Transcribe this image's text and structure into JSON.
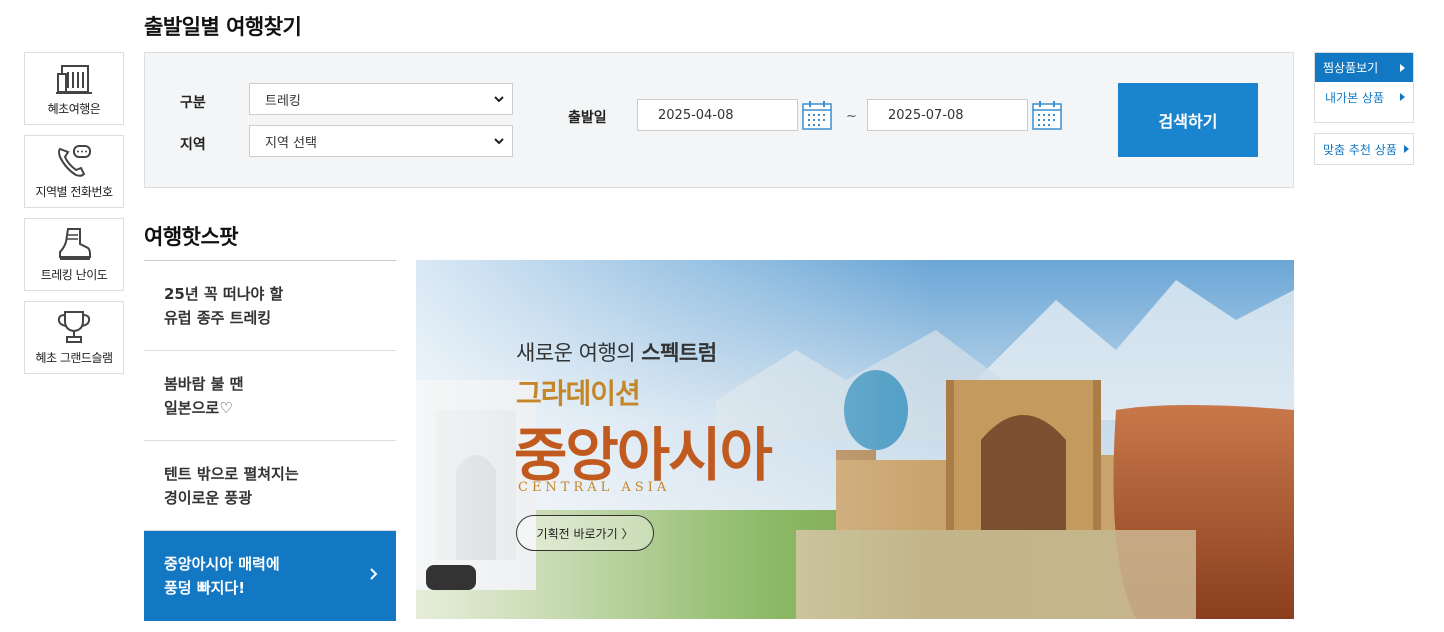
{
  "quick_menu": [
    {
      "label": "혜초여행은",
      "icon": "building-icon"
    },
    {
      "label": "지역별 전화번호",
      "icon": "phone-icon"
    },
    {
      "label": "트레킹 난이도",
      "icon": "boot-icon"
    },
    {
      "label": "혜초 그랜드슬램",
      "icon": "trophy-icon"
    }
  ],
  "search": {
    "title": "출발일별 여행찾기",
    "category_label": "구분",
    "category_value": "트레킹",
    "region_label": "지역",
    "region_value": "지역 선택",
    "date_label": "출발일",
    "date_from": "2025-04-08",
    "date_sep": "~",
    "date_to": "2025-07-08",
    "submit_label": "검색하기"
  },
  "hotspot": {
    "title": "여행핫스팟",
    "items": [
      {
        "line1": "25년 꼭 떠나야 할",
        "line2": "유럽 종주 트레킹"
      },
      {
        "line1": "봄바람 불 땐",
        "line2": "일본으로♡"
      },
      {
        "line1": "텐트 밖으로 펼쳐지는",
        "line2": "경이로운 풍광"
      },
      {
        "line1": "중앙아시아 매력에",
        "line2": "풍덩 빠지다!"
      }
    ]
  },
  "banner": {
    "sub_normal": "새로운 여행의 ",
    "sub_bold": "스펙트럼",
    "brand": "그라데이션",
    "main": "중앙아시아",
    "english": "CENTRAL ASIA",
    "button": "기획전 바로가기 〉"
  },
  "right_quick": {
    "wishlist": "찜상품보기",
    "viewed": "내가본 상품",
    "recommend": "맞춤 추천 상품"
  },
  "colors": {
    "accent": "#1378c4",
    "button": "#1b84cf"
  }
}
